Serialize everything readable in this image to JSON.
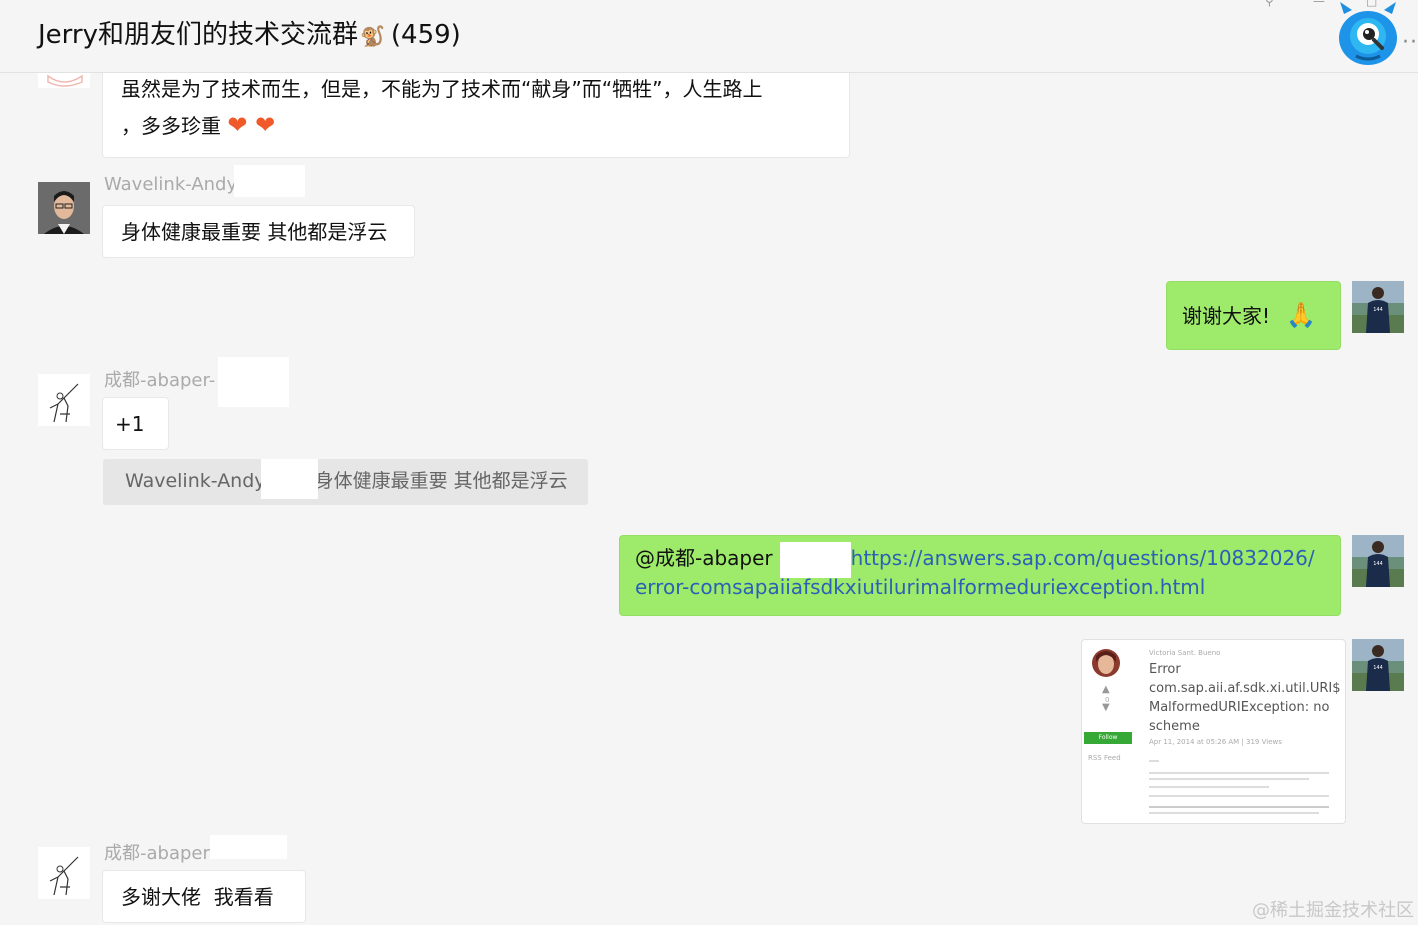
{
  "header": {
    "title": "Jerry和朋友们的技术交流群",
    "title_emoji": "🐒",
    "member_count": "(459)"
  },
  "messages": {
    "m1": {
      "line1": "虽然是为了技术而生，但是，不能为了技术而“献身”而“牺牲”，人生路上",
      "line2": "，多多珍重",
      "hearts": "❤ ❤"
    },
    "m2": {
      "sender": "Wavelink-Andy",
      "text": "身体健康最重要 其他都是浮云"
    },
    "m3": {
      "text": "谢谢大家!",
      "emoji": "🙏"
    },
    "m4": {
      "sender": "成都-abaper-",
      "text": "+1",
      "quote_sender": "Wavelink-Andy",
      "quote_sep": "：",
      "quote_text": "身体健康最重要 其他都是浮云"
    },
    "m5": {
      "mention": "@成都-abaper",
      "link_line1": "https://answers.sap.com/questions/10832026/",
      "link_line2": "error-comsapaiiafsdkxiutilurimalformeduriexception.html"
    },
    "m6_card": {
      "author": "Victoria Sant. Bueno",
      "title": "Error com.sap.aii.af.sdk.xi.util.URI$ MalformedURIException: no scheme",
      "meta": "Apr 11, 2014 at 05:26 AM | 319 Views",
      "follow": "Follow",
      "rss": "RSS Feed"
    },
    "m7": {
      "sender": "成都-abaper",
      "text": "多谢大佬  我看看"
    }
  },
  "watermark": "@稀土掘金技术社区"
}
